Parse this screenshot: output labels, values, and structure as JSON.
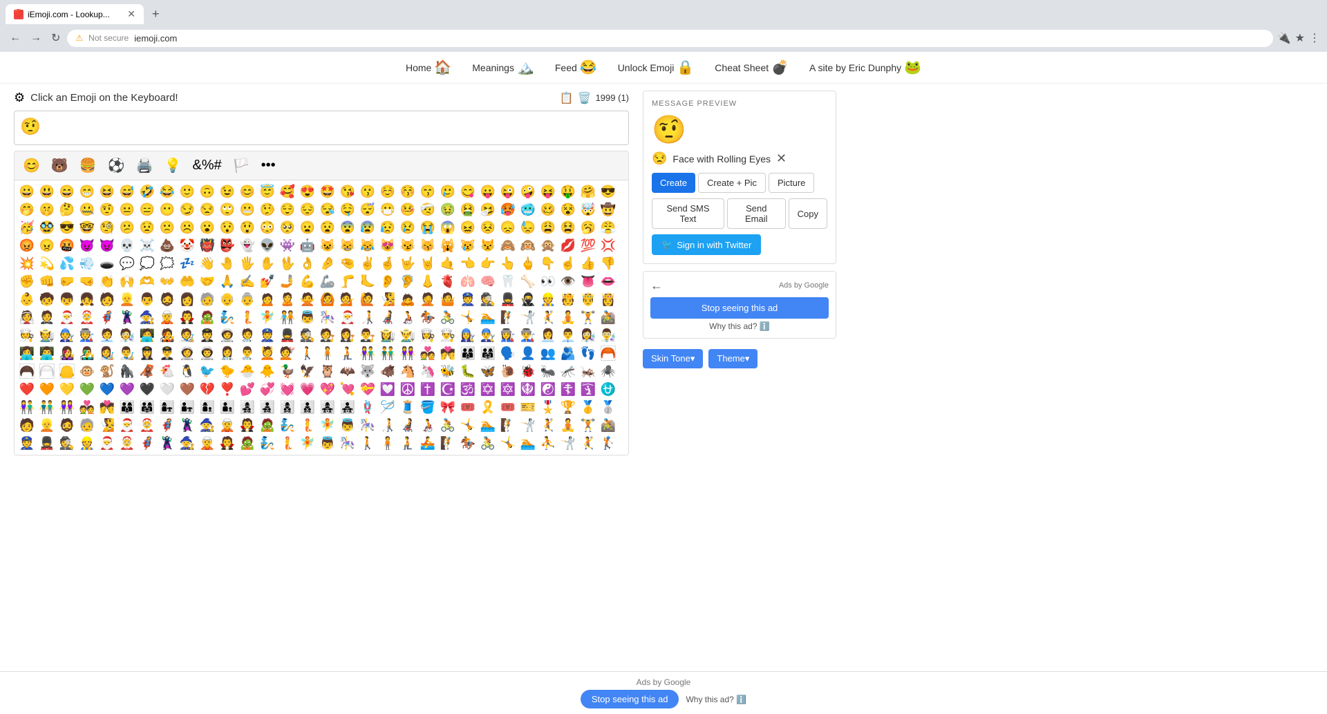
{
  "browser": {
    "tab_title": "iEmoji.com - Lookup...",
    "tab_favicon": "🔴",
    "url": "iemoji.com",
    "security_text": "Not secure"
  },
  "nav": {
    "items": [
      {
        "label": "Home",
        "emoji": "🏠"
      },
      {
        "label": "Meanings",
        "emoji": "🏔️"
      },
      {
        "label": "Feed",
        "emoji": "😂"
      },
      {
        "label": "Unlock Emoji",
        "emoji": "🔒"
      },
      {
        "label": "Cheat Sheet",
        "emoji": "💣"
      },
      {
        "label": "A site by Eric Dunphy",
        "emoji": "🐸"
      }
    ]
  },
  "toolbar": {
    "prompt": "Click an Emoji on the Keyboard!",
    "char_count": "1999 (1)"
  },
  "text_area": {
    "value": "🤨"
  },
  "emoji_tabs": [
    "😊",
    "🐻",
    "🍔",
    "⚽",
    "🖨️",
    "💡",
    "&%#",
    "🏳️",
    "•••"
  ],
  "emoji_rows": [
    [
      "😀",
      "😃",
      "😄",
      "😁",
      "😆",
      "😅",
      "🤣",
      "😂",
      "🙂",
      "🙃",
      "😉",
      "😊",
      "😇",
      "🥰",
      "😍",
      "🤩",
      "😘",
      "😗",
      "☺️",
      "😚",
      "😙",
      "🥲",
      "😋",
      "😛",
      "😜",
      "🤪",
      "😝",
      "🤑",
      "🤗",
      "😎"
    ],
    [
      "🤭",
      "🤫",
      "🤔",
      "🤐",
      "🤨",
      "😐",
      "😑",
      "😶",
      "😏",
      "😒",
      "🙄",
      "😬",
      "🤥",
      "😌",
      "😔",
      "😪",
      "🤤",
      "😴",
      "😷",
      "🤒",
      "🤕",
      "🤢",
      "🤮",
      "🤧",
      "🥵",
      "🥶",
      "🥴",
      "😵",
      "🤯",
      "🤠"
    ],
    [
      "🥳",
      "🥸",
      "😎",
      "🤓",
      "🧐",
      "😕",
      "😟",
      "🙁",
      "☹️",
      "😮",
      "😯",
      "😲",
      "😳",
      "🥺",
      "😦",
      "😧",
      "😨",
      "😰",
      "😥",
      "😢",
      "😭",
      "😱",
      "😖",
      "😣",
      "😞",
      "😓",
      "😩",
      "😫",
      "🥱",
      "😤"
    ],
    [
      "😡",
      "😠",
      "🤬",
      "😈",
      "👿",
      "💀",
      "☠️",
      "💩",
      "🤡",
      "👹",
      "👺",
      "👻",
      "👽",
      "👾",
      "🤖",
      "😺",
      "😸",
      "😹",
      "😻",
      "😼",
      "😽",
      "🙀",
      "😿",
      "😾",
      "🙈",
      "🙉",
      "🙊",
      "💋",
      "💯",
      "💢"
    ],
    [
      "💥",
      "💫",
      "💦",
      "💨",
      "🕳️",
      "💬",
      "💭",
      "🗯️",
      "💤",
      "👋",
      "🤚",
      "🖐️",
      "✋",
      "🖖",
      "👌",
      "🤌",
      "🤏",
      "✌️",
      "🤞",
      "🤟",
      "🤘",
      "🤙",
      "👈",
      "👉",
      "👆",
      "🖕",
      "👇",
      "☝️",
      "👍",
      "👎"
    ],
    [
      "✊",
      "👊",
      "🤛",
      "🤜",
      "👏",
      "🙌",
      "🫶",
      "👐",
      "🤲",
      "🤝",
      "🙏",
      "✍️",
      "💅",
      "🤳",
      "💪",
      "🦾",
      "🦵",
      "🦶",
      "👂",
      "🦻",
      "👃",
      "🫀",
      "🫁",
      "🧠",
      "🦷",
      "🦴",
      "👀",
      "👁️",
      "👅",
      "👄"
    ],
    [
      "👶",
      "🧒",
      "👦",
      "👧",
      "🧑",
      "👱",
      "👨",
      "🧔",
      "👩",
      "🧓",
      "👴",
      "👵",
      "🙍",
      "🙎",
      "🙅",
      "🙆",
      "💁",
      "🙋",
      "🧏",
      "🙇",
      "🤦",
      "🤷",
      "👮",
      "🕵️",
      "💂",
      "🥷",
      "👷",
      "🫅",
      "🤴",
      "👸"
    ],
    [
      "👰",
      "🤵",
      "🎅",
      "🤶",
      "🦸",
      "🦹",
      "🧙",
      "🧝",
      "🧛",
      "🧟",
      "🧞",
      "🧜",
      "🧚",
      "🧑‍🤝‍🧑",
      "👼",
      "🎠",
      "🎅",
      "🧑‍🦯",
      "🧑‍🦼",
      "🧑‍🦽",
      "🏇",
      "🚴",
      "🤸",
      "🏊",
      "🧗",
      "🤺",
      "🤾",
      "🧘",
      "🏋️",
      "🚵"
    ],
    [
      "🧑‍🍳",
      "🧑‍🌾",
      "🧑‍🔧",
      "🧑‍🏭",
      "🧑‍💼",
      "🧑‍🔬",
      "🧑‍💻",
      "🧑‍🎤",
      "🧑‍🎨",
      "🧑‍✈️",
      "🧑‍🚀",
      "🧑‍⚕️",
      "👮",
      "💂",
      "🕵️",
      "🧑‍⚖️",
      "👩‍⚖️",
      "👨‍⚖️",
      "👩‍🌾",
      "👨‍🌾",
      "👩‍🍳",
      "👨‍🍳",
      "👩‍🔧",
      "👨‍🔧",
      "👩‍🏭",
      "👨‍🏭",
      "👩‍💼",
      "👨‍💼",
      "👩‍🔬",
      "👨‍🔬"
    ],
    [
      "👩‍💻",
      "👨‍💻",
      "👩‍🎤",
      "👨‍🎤",
      "👩‍🎨",
      "👨‍🎨",
      "👩‍✈️",
      "👨‍✈️",
      "👩‍🚀",
      "👨‍🚀",
      "👩‍⚕️",
      "👨‍⚕️",
      "💆",
      "💇",
      "🚶",
      "🧍",
      "🧎",
      "👫",
      "👬",
      "👭",
      "💑",
      "💏",
      "👨‍👩‍👦",
      "👨‍👩‍👧",
      "🗣️",
      "👤",
      "👥",
      "🫂",
      "👣",
      "🦰"
    ],
    [
      "🦱",
      "🦳",
      "🦲",
      "🐵",
      "🐒",
      "🦍",
      "🦧",
      "🐔",
      "🐧",
      "🐦",
      "🐤",
      "🐣",
      "🐥",
      "🦆",
      "🦅",
      "🦉",
      "🦇",
      "🐺",
      "🐗",
      "🐴",
      "🦄",
      "🐝",
      "🐛",
      "🦋",
      "🐌",
      "🐞",
      "🐜",
      "🦟",
      "🦗",
      "🕷️"
    ],
    [
      "❤️",
      "🧡",
      "💛",
      "💚",
      "💙",
      "💜",
      "🖤",
      "🤍",
      "🤎",
      "💔",
      "❣️",
      "💕",
      "💞",
      "💓",
      "💗",
      "💖",
      "💘",
      "💝",
      "💟",
      "☮️",
      "✝️",
      "☪️",
      "🕉️",
      "✡️",
      "🔯",
      "🪯",
      "☯️",
      "☦️",
      "🛐",
      "⛎"
    ],
    [
      "👫",
      "👬",
      "👭",
      "💑",
      "💏",
      "👨‍👩‍👦",
      "👨‍👩‍👧",
      "👩‍👧",
      "👨‍👧",
      "👩‍👦",
      "👨‍👦",
      "👩‍👧‍👦",
      "👨‍👧‍👦",
      "👩‍👦‍👦",
      "👨‍👦‍👦",
      "👩‍👧‍👧",
      "👨‍👧‍👧",
      "🪢",
      "🪡",
      "🧵",
      "🪣",
      "🎀",
      "🎟️",
      "🎗️",
      "🎟️",
      "🎫",
      "🎖️",
      "🏆",
      "🥇",
      "🥈"
    ],
    [
      "🧑",
      "👱",
      "🧔",
      "🧓",
      "🧏",
      "🎅",
      "🤶",
      "🦸",
      "🦹",
      "🧙",
      "🧝",
      "🧛",
      "🧟",
      "🧞",
      "🧜",
      "🧚",
      "👼",
      "🎠",
      "🧑‍🦯",
      "🧑‍🦼",
      "🧑‍🦽",
      "🚴",
      "🤸",
      "🏊",
      "🧗",
      "🤺",
      "🤾",
      "🧘",
      "🏋️",
      "🚵"
    ],
    [
      "👮",
      "💂",
      "🕵️",
      "👷",
      "🎅",
      "🤶",
      "🦸",
      "🦹",
      "🧙",
      "🧝",
      "🧛",
      "🧟",
      "🧞",
      "🧜",
      "🧚",
      "👼",
      "🎠",
      "🚶",
      "🧍",
      "🧎",
      "🚣",
      "🧗",
      "🏇",
      "🚴",
      "🤸",
      "🏊",
      "⛹️",
      "🤺",
      "🤾",
      "🏌️"
    ]
  ],
  "preview": {
    "header": "MESSAGE PREVIEW",
    "emoji": "🤨",
    "emoji_name": "Face with Rolling Eyes",
    "emoji_icon": "😒"
  },
  "action_buttons": {
    "create": "Create",
    "create_pic": "Create + Pic",
    "picture": "Picture"
  },
  "send_buttons": {
    "sms": "Send SMS Text",
    "email": "Send Email",
    "copy": "Copy"
  },
  "twitter": {
    "label": "Sign in with Twitter",
    "icon": "🐦"
  },
  "ads": {
    "by_google": "Ads by Google",
    "stop_seeing": "Stop seeing this ad",
    "why_this_ad": "Why this ad?"
  },
  "bottom_tools": {
    "skin_tone": "Skin Tone▾",
    "theme": "Theme▾"
  },
  "bottom_ads": {
    "label": "Ads by Google",
    "stop": "Stop seeing this ad",
    "why": "Why this ad?"
  }
}
